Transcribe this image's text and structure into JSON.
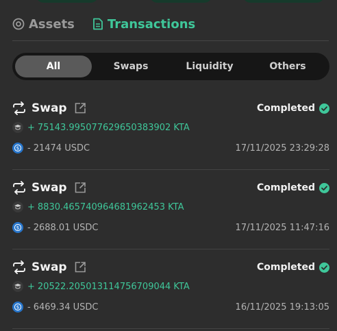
{
  "view_tabs": {
    "assets": "Assets",
    "transactions": "Transactions"
  },
  "filters": [
    "All",
    "Swaps",
    "Liquidity",
    "Others"
  ],
  "transactions": [
    {
      "type": "Swap",
      "status": "Completed",
      "in_sign": "+",
      "in_amount": "75143.995077629650383902 KTA",
      "out_sign": "-",
      "out_amount": "21474 USDC",
      "timestamp": "17/11/2025 23:29:28"
    },
    {
      "type": "Swap",
      "status": "Completed",
      "in_sign": "+",
      "in_amount": "8830.465740964681962453 KTA",
      "out_sign": "-",
      "out_amount": "2688.01 USDC",
      "timestamp": "17/11/2025 11:47:16"
    },
    {
      "type": "Swap",
      "status": "Completed",
      "in_sign": "+",
      "in_amount": "20522.205013114756709044 KTA",
      "out_sign": "-",
      "out_amount": "6469.34 USDC",
      "timestamp": "16/11/2025 19:13:05"
    }
  ],
  "icons": {
    "assets": "circle-dot-icon",
    "transactions": "document-icon",
    "swap": "swap-arrows-icon",
    "external": "external-link-icon",
    "status": "check-circle-icon"
  },
  "colors": {
    "accent": "#3fc79a",
    "background": "#2d2d2d",
    "segment_bg": "#161616",
    "segment_active": "#5a5a5a",
    "usdc": "#2775ca"
  }
}
